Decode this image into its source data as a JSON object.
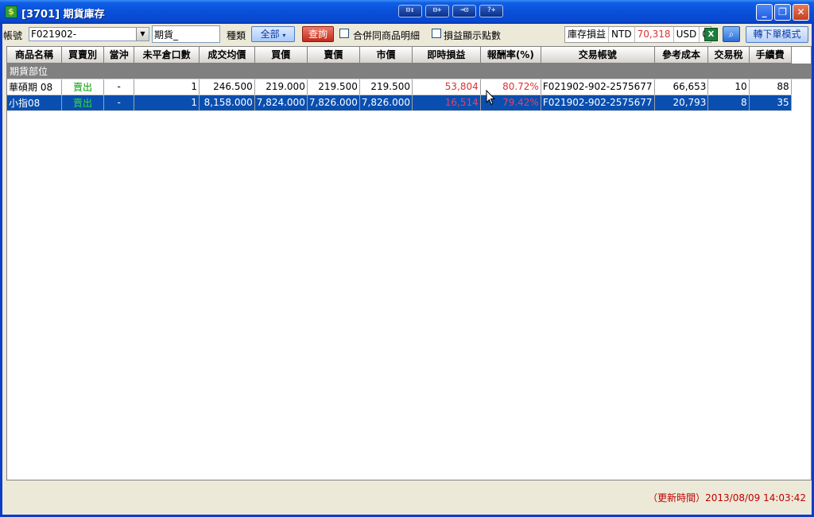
{
  "window": {
    "title": "[3701] 期貨庫存",
    "app_icon": "app-logo-icon",
    "mid_buttons": [
      "⊟↕",
      "⊟+",
      "⊸⊡",
      "?+"
    ]
  },
  "toolbar": {
    "account_label": "帳號",
    "account_value": "F021902-",
    "product_type_value": "期貨_",
    "category_label": "種類",
    "category_button": "全部",
    "query_button": "查詢",
    "merge_checkbox_label": "合併同商品明細",
    "profit_points_checkbox_label": "損益顯示點數",
    "inventory_pl_label": "庫存損益",
    "ntd_label": "NTD",
    "ntd_value": "70,318",
    "usd_label": "USD",
    "usd_value": "0",
    "mode_button": "轉下單模式"
  },
  "table": {
    "columns": [
      "商品名稱",
      "買賣別",
      "當沖",
      "未平倉口數",
      "成交均價",
      "買價",
      "賣價",
      "市價",
      "即時損益",
      "報酬率(%)",
      "交易帳號",
      "參考成本",
      "交易稅",
      "手續費"
    ],
    "group_label": "期貨部位",
    "rows": [
      [
        "華碩期 08",
        "賣出",
        "-",
        "1",
        "246.500",
        "219.000",
        "219.500",
        "219.500",
        "53,804",
        "80.72%",
        "F021902-902-2575677",
        "66,653",
        "10",
        "88"
      ],
      [
        "小指08",
        "賣出",
        "-",
        "1",
        "8,158.000",
        "7,824.000",
        "7,826.000",
        "7,826.000",
        "16,514",
        "79.42%",
        "F021902-902-2575677",
        "20,793",
        "8",
        "35"
      ]
    ]
  },
  "status": {
    "update_time": "（更新時間）2013/08/09 14:03:42"
  },
  "colors": {
    "titlebar": "#0A4FD8",
    "selected_row": "#0A4FB0",
    "profit_red": "#E03030",
    "sell_green": "#00A000"
  }
}
